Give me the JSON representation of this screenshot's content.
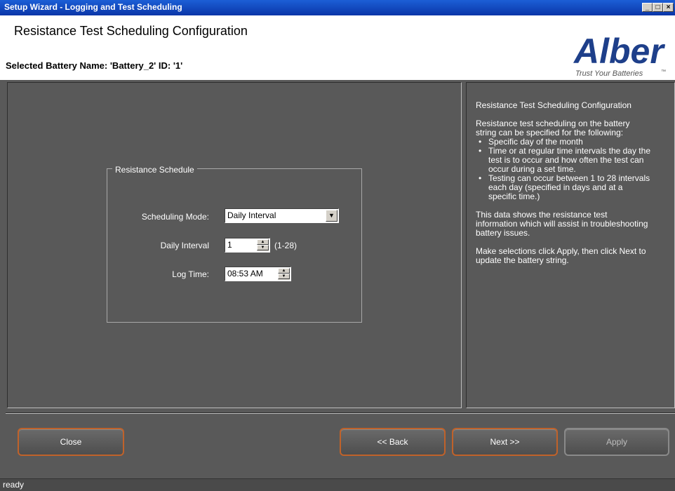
{
  "window": {
    "title": "Setup Wizard - Logging and Test Scheduling",
    "controls": {
      "minimize": "_",
      "maximize": "□",
      "close": "×"
    }
  },
  "header": {
    "title": "Resistance Test Scheduling Configuration",
    "battery_info": "Selected Battery Name: 'Battery_2' ID: '1'",
    "logo": {
      "brand": "Alber",
      "tagline": "Trust Your Batteries",
      "trademark": "™",
      "color": "#1e3f8a"
    }
  },
  "schedule": {
    "group_label": "Resistance Schedule",
    "scheduling_mode_label": "Scheduling Mode:",
    "scheduling_mode_value": "Daily Interval",
    "daily_interval_label": "Daily Interval",
    "daily_interval_value": "1",
    "daily_interval_range": "(1-28)",
    "log_time_label": "Log Time:",
    "log_time_value": "08:53 AM"
  },
  "help": {
    "heading": "Resistance Test Scheduling Configuration",
    "intro": "Resistance test scheduling on the battery string can be specified for the following:",
    "bullets": [
      "Specific day of the month",
      "Time or at regular time intervals the day the test is to occur and how often the test can occur during a set time.",
      "Testing can occur between 1 to 28 intervals each day (specified in days and at a specific time.)"
    ],
    "info": "This data shows the resistance test information which will assist in troubleshooting battery issues.",
    "instructions": "Make selections click Apply, then click Next to update the battery string."
  },
  "buttons": {
    "close": "Close",
    "back": "<< Back",
    "next": "Next >>",
    "apply": "Apply"
  },
  "status": {
    "text": "ready"
  },
  "colors": {
    "accent_border": "#c0622a",
    "panel_bg": "#595959",
    "titlebar": "#0a35a8"
  }
}
